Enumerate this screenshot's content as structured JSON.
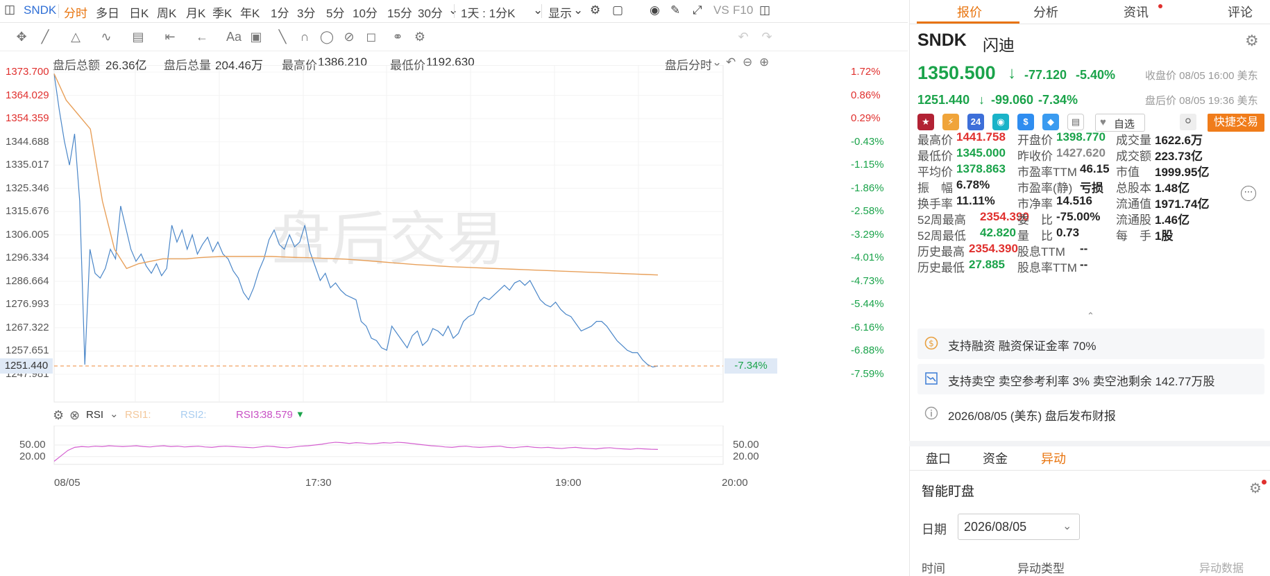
{
  "toolbar": {
    "symbol": "SNDK",
    "periods": [
      "分时",
      "多日",
      "日K",
      "周K",
      "月K",
      "季K",
      "年K",
      "1分",
      "3分",
      "5分",
      "10分",
      "15分",
      "30分"
    ],
    "active_period": "分时",
    "range_select": "1天 : 1分K",
    "display_label": "显示",
    "vs_label": "VS",
    "f10_label": "F10"
  },
  "drawbar": {
    "text_tool": "Aa"
  },
  "info": {
    "after_amount_label": "盘后总额",
    "after_amount": "26.36亿",
    "after_volume_label": "盘后总量",
    "after_volume": "204.46万",
    "high_label": "最高价",
    "high": "1386.210",
    "low_label": "最低价",
    "low": "1192.630",
    "mode_label": "盘后分时"
  },
  "chart_data": {
    "type": "line",
    "title": "",
    "watermark": "盘后交易",
    "y_left_ticks": [
      "1373.700",
      "1364.029",
      "1354.359",
      "1344.688",
      "1335.017",
      "1325.346",
      "1315.676",
      "1306.005",
      "1296.334",
      "1286.664",
      "1276.993",
      "1267.322",
      "1257.651",
      "1247.981"
    ],
    "y_right_ticks": [
      "1.72%",
      "0.86%",
      "0.29%",
      "-0.43%",
      "-1.15%",
      "-1.86%",
      "-2.58%",
      "-3.29%",
      "-4.01%",
      "-4.73%",
      "-5.44%",
      "-6.16%",
      "-6.88%",
      "-7.59%"
    ],
    "current_price_label": "1251.440",
    "current_pct_label": "-7.34%",
    "x_ticks": [
      "08/05",
      "17:30",
      "19:00",
      "20:00"
    ],
    "ylim": [
      1247.981,
      1373.7
    ],
    "series": [
      {
        "name": "price",
        "color": "#4a86c8",
        "values": [
          1373,
          1358,
          1345,
          1335,
          1348,
          1320,
          1252,
          1300,
          1290,
          1288,
          1292,
          1300,
          1296,
          1318,
          1309,
          1300,
          1295,
          1298,
          1293,
          1290,
          1294,
          1289,
          1292,
          1310,
          1303,
          1308,
          1300,
          1306,
          1298,
          1302,
          1305,
          1299,
          1303,
          1298,
          1296,
          1291,
          1288,
          1282,
          1279,
          1284,
          1291,
          1296,
          1304,
          1308,
          1302,
          1300,
          1306,
          1301,
          1303,
          1310,
          1299,
          1293,
          1287,
          1290,
          1284,
          1286,
          1283,
          1281,
          1280,
          1279,
          1270,
          1268,
          1263,
          1262,
          1259,
          1258,
          1268,
          1265,
          1262,
          1259,
          1264,
          1266,
          1260,
          1262,
          1267,
          1266,
          1264,
          1268,
          1263,
          1265,
          1270,
          1272,
          1273,
          1278,
          1280,
          1279,
          1281,
          1283,
          1285,
          1283,
          1286,
          1287,
          1285,
          1287,
          1283,
          1279,
          1277,
          1276,
          1278,
          1275,
          1273,
          1272,
          1269,
          1266,
          1267,
          1268,
          1270,
          1270,
          1268,
          1265,
          1262,
          1260,
          1258,
          1257,
          1257,
          1254,
          1252,
          1251,
          1251.44
        ]
      },
      {
        "name": "avg",
        "color": "#e8a05a",
        "values": [
          1373,
          1362,
          1356,
          1350,
          1320,
          1300,
          1292,
          1294,
          1295,
          1296,
          1296,
          1296,
          1296.5,
          1296.8,
          1297,
          1297,
          1297,
          1297,
          1297,
          1296.8,
          1296.6,
          1296.5,
          1296.3,
          1296.1,
          1295.9,
          1295.6,
          1295.2,
          1294.8,
          1294.4,
          1294,
          1293.6,
          1293.3,
          1293,
          1292.7,
          1292.5,
          1292.3,
          1292.1,
          1291.9,
          1291.7,
          1291.5,
          1291.3,
          1291.1,
          1290.9,
          1290.7,
          1290.5,
          1290.3,
          1290.1,
          1289.9,
          1289.7,
          1289.5,
          1289.3
        ]
      }
    ],
    "rsi": {
      "label": "RSI",
      "rsi1_label": "RSI1:",
      "rsi2_label": "RSI2:",
      "rsi3_label": "RSI3:",
      "rsi3_value": "38.579",
      "ticks": [
        "50.00",
        "20.00"
      ],
      "values": [
        8,
        22,
        36,
        44,
        46,
        45,
        47,
        46,
        48,
        47,
        46,
        47,
        48,
        46,
        45,
        47,
        48,
        46,
        47,
        45,
        46,
        47,
        45,
        44,
        46,
        47,
        46,
        45,
        44,
        43,
        45,
        47,
        46,
        44,
        43,
        45,
        47,
        48,
        50,
        52,
        55,
        57,
        56,
        54,
        56,
        55,
        53,
        54,
        56,
        55,
        57,
        56,
        54,
        52,
        50,
        48,
        47,
        45,
        44,
        46,
        47,
        45,
        44,
        45,
        46,
        47,
        44,
        43,
        45,
        46,
        44,
        43,
        44,
        42,
        41,
        43,
        44,
        42,
        41,
        40,
        42,
        43,
        41,
        40,
        39,
        41,
        40,
        39,
        38.6
      ]
    }
  },
  "panel": {
    "tabs": [
      "报价",
      "分析",
      "资讯",
      "评论"
    ],
    "active_tab": "报价",
    "ticker": "SNDK",
    "name": "闪迪",
    "price": "1350.500",
    "change": "-77.120",
    "change_pct": "-5.40%",
    "close_note": "收盘价 08/05 16:00 美东",
    "after_price": "1251.440",
    "after_change": "-99.060",
    "after_pct": "-7.34%",
    "after_note": "盘后价 08/05 19:36 美东",
    "watch_label": "自选",
    "quick_trade": "快捷交易",
    "stats": [
      {
        "label": "最高价",
        "value": "1441.758",
        "color": "red"
      },
      {
        "label": "开盘价",
        "value": "1398.770",
        "color": "green"
      },
      {
        "label": "成交量",
        "value": "1622.6万",
        "color": "dark"
      },
      {
        "label": "最低价",
        "value": "1345.000",
        "color": "green"
      },
      {
        "label": "昨收价",
        "value": "1427.620",
        "color": "gray"
      },
      {
        "label": "成交额",
        "value": "223.73亿",
        "color": "dark"
      },
      {
        "label": "平均价",
        "value": "1378.863",
        "color": "green"
      },
      {
        "label": "市盈率TTM",
        "value": "46.15",
        "color": "dark"
      },
      {
        "label": "市值",
        "value": "1999.95亿",
        "color": "dark"
      },
      {
        "label": "振　幅",
        "value": "6.78%",
        "color": "dark"
      },
      {
        "label": "市盈率(静)",
        "value": "亏损",
        "color": "dark"
      },
      {
        "label": "总股本",
        "value": "1.48亿",
        "color": "dark"
      },
      {
        "label": "换手率",
        "value": "11.11%",
        "color": "dark"
      },
      {
        "label": "市净率",
        "value": "14.516",
        "color": "dark"
      },
      {
        "label": "流通值",
        "value": "1971.74亿",
        "color": "dark"
      },
      {
        "label": "52周最高",
        "value": "2354.390",
        "color": "red"
      },
      {
        "label": "委　比",
        "value": "-75.00%",
        "color": "dark"
      },
      {
        "label": "流通股",
        "value": "1.46亿",
        "color": "dark"
      },
      {
        "label": "52周最低",
        "value": "42.820",
        "color": "green"
      },
      {
        "label": "量　比",
        "value": "0.73",
        "color": "dark"
      },
      {
        "label": "每　手",
        "value": "1股",
        "color": "dark"
      },
      {
        "label": "历史最高",
        "value": "2354.390",
        "color": "red"
      },
      {
        "label": "股息TTM",
        "value": "--",
        "color": "dark"
      },
      {
        "label": "",
        "value": "",
        "color": "dark"
      },
      {
        "label": "历史最低",
        "value": "27.885",
        "color": "green"
      },
      {
        "label": "股息率TTM",
        "value": "--",
        "color": "dark"
      }
    ],
    "notices": [
      "支持融资 融资保证金率 70%",
      "支持卖空 卖空参考利率 3% 卖空池剩余 142.77万股",
      "2026/08/05 (美东) 盘后发布财报"
    ],
    "subtabs": [
      "盘口",
      "资金",
      "异动"
    ],
    "active_subtab": "异动",
    "monitor_title": "智能盯盘",
    "date_label": "日期",
    "date_value": "2026/08/05",
    "table_headers": [
      "时间",
      "异动类型"
    ],
    "footer_text": "异动数据",
    "colors": {
      "up": "#e0302e",
      "down": "#1aa34a",
      "accent": "#e8730c",
      "blue": "#2f6fd6"
    }
  }
}
